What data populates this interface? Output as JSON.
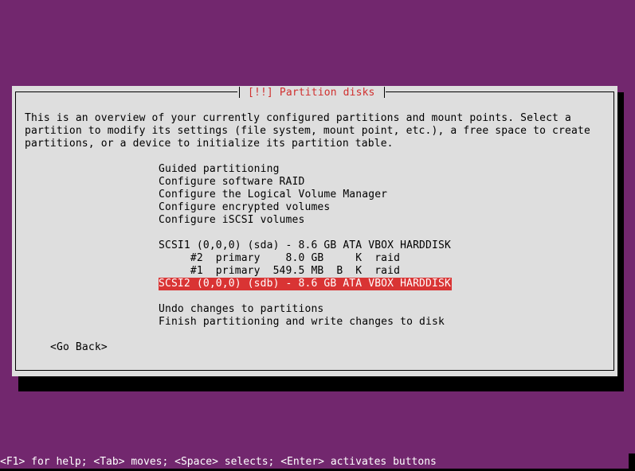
{
  "dialog": {
    "title": "[!!] Partition disks",
    "description": [
      "This is an overview of your currently configured partitions and mount points. Select a",
      "partition to modify its settings (file system, mount point, etc.), a free space to create",
      "partitions, or a device to initialize its partition table."
    ],
    "menu": [
      {
        "label": "Guided partitioning"
      },
      {
        "label": "Configure software RAID"
      },
      {
        "label": "Configure the Logical Volume Manager"
      },
      {
        "label": "Configure encrypted volumes"
      },
      {
        "label": "Configure iSCSI volumes"
      }
    ],
    "devices": [
      {
        "label": "SCSI1 (0,0,0) (sda) - 8.6 GB ATA VBOX HARDDISK",
        "selected": false
      },
      {
        "label": "     #2  primary    8.0 GB     K  raid",
        "selected": false
      },
      {
        "label": "     #1  primary  549.5 MB  B  K  raid",
        "selected": false
      },
      {
        "label": "SCSI2 (0,0,0) (sdb) - 8.6 GB ATA VBOX HARDDISK",
        "selected": true
      }
    ],
    "actions": [
      {
        "label": "Undo changes to partitions"
      },
      {
        "label": "Finish partitioning and write changes to disk"
      }
    ],
    "go_back_label": "<Go Back>"
  },
  "status_bar": {
    "help_text": "<F1> for help; <Tab> moves; <Space> selects; <Enter> activates buttons"
  },
  "colors": {
    "background": "#72276e",
    "dialog": "#dedede",
    "title": "#d0302f",
    "selection": "#d93434"
  }
}
